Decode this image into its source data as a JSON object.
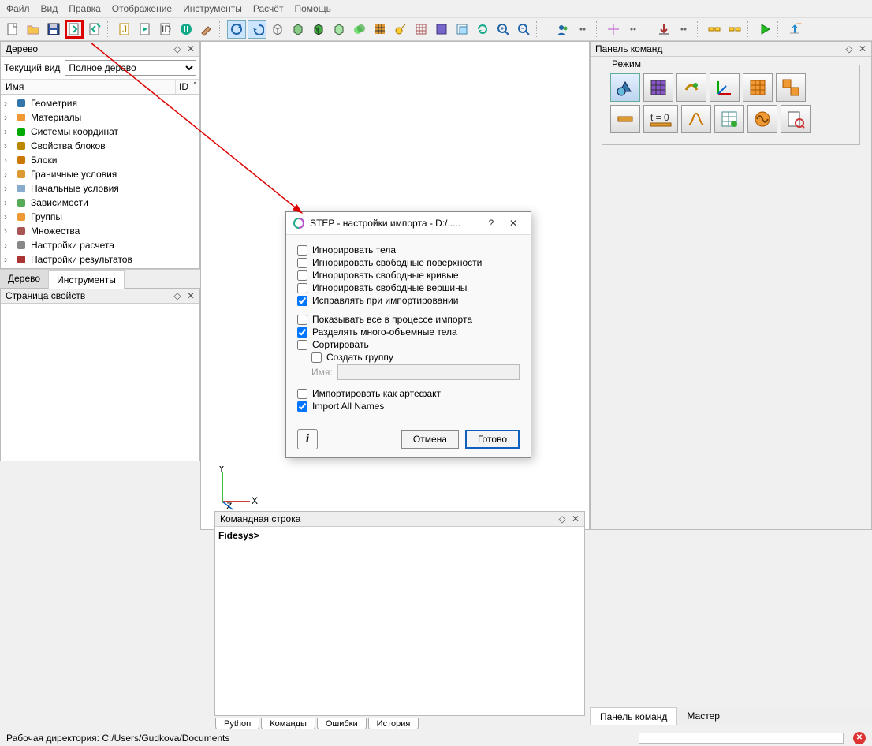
{
  "menubar": [
    "Файл",
    "Вид",
    "Правка",
    "Отображение",
    "Инструменты",
    "Расчёт",
    "Помощь"
  ],
  "panels": {
    "tree_title": "Дерево",
    "current_view_label": "Текущий вид",
    "view_select_value": "Полное дерево",
    "col_name": "Имя",
    "col_id": "ID",
    "tree_items": [
      {
        "label": "Геометрия",
        "icon": "geom"
      },
      {
        "label": "Материалы",
        "icon": "mat"
      },
      {
        "label": "Системы координат",
        "icon": "coord"
      },
      {
        "label": "Свойства блоков",
        "icon": "props"
      },
      {
        "label": "Блоки",
        "icon": "blocks"
      },
      {
        "label": "Граничные условия",
        "icon": "bc"
      },
      {
        "label": "Начальные условия",
        "icon": "ic"
      },
      {
        "label": "Зависимости",
        "icon": "deps"
      },
      {
        "label": "Группы",
        "icon": "groups"
      },
      {
        "label": "Множества",
        "icon": "sets"
      },
      {
        "label": "Настройки расчета",
        "icon": "calc"
      },
      {
        "label": "Настройки результатов",
        "icon": "res"
      }
    ],
    "tab_tree": "Дерево",
    "tab_tools": "Инструменты",
    "props_title": "Страница свойств",
    "right_title": "Панель команд",
    "mode_legend": "Режим",
    "cmdline_title": "Командная строка",
    "cmdline_prompt": "Fidesys>",
    "cmd_tabs": [
      "Python",
      "Команды",
      "Ошибки",
      "История"
    ],
    "right_tabs": [
      "Панель команд",
      "Мастер"
    ]
  },
  "dialog": {
    "title": "STEP - настройки импорта - D:/.....",
    "help_btn": "?",
    "close_btn": "✕",
    "rows": [
      {
        "label": "Игнорировать тела",
        "checked": false
      },
      {
        "label": "Игнорировать свободные поверхности",
        "checked": false
      },
      {
        "label": "Игнорировать свободные кривые",
        "checked": false
      },
      {
        "label": "Игнорировать свободные вершины",
        "checked": false
      },
      {
        "label": "Исправлять при импортировании",
        "checked": true
      }
    ],
    "rows2": [
      {
        "label": "Показывать все в процессе импорта",
        "checked": false
      },
      {
        "label": "Разделять много-объемные тела",
        "checked": true
      },
      {
        "label": "Сортировать",
        "checked": false
      }
    ],
    "create_group": {
      "label": "Создать группу",
      "checked": false
    },
    "name_label": "Имя:",
    "name_value": "",
    "rows3": [
      {
        "label": "Импортировать как артефакт",
        "checked": false
      },
      {
        "label": "Import All Names",
        "checked": true
      }
    ],
    "btn_cancel": "Отмена",
    "btn_ok": "Готово"
  },
  "statusbar": {
    "text": "Рабочая директория: C:/Users/Gudkova/Documents"
  },
  "axis": {
    "x": "X",
    "y": "Y",
    "z": "Z"
  },
  "colors": {
    "highlight": "#d00",
    "primary": "#1060c0"
  }
}
